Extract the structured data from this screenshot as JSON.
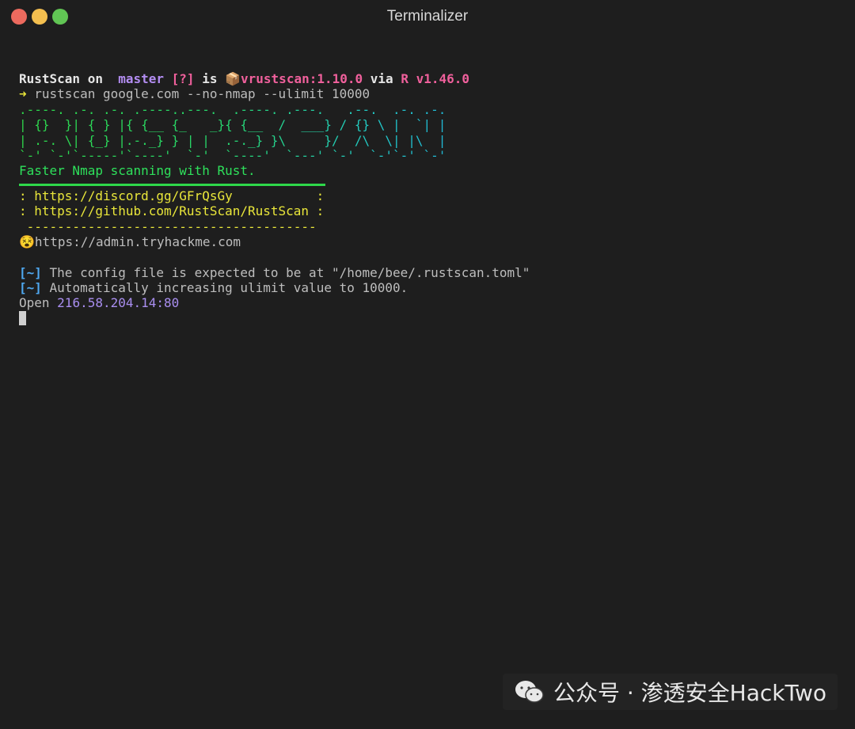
{
  "window": {
    "title": "Terminalizer"
  },
  "prompt": {
    "dir": "RustScan",
    "on": " on ",
    "branch_icon": "",
    "branch": " master",
    "status": " [?]",
    "is": " is ",
    "package_icon": "📦",
    "package": "vrustscan:1.10.0",
    "via": " via ",
    "rust_icon": "R",
    "rust_version": " v1.46.0"
  },
  "command": {
    "arrow": "➜",
    "text": " rustscan google.com --no-nmap --ulimit 10000"
  },
  "banner": {
    "ascii": [
      ".----. .-. .-. .----..---.  .----. .---.   .--.  .-. .-.",
      "| {}  }| { } |{ {__ {_   _}{ {__  /  ___} / {} \\ |  `| |",
      "| .-. \\| {_} |.-._} } | |  .-._} }\\     }/  /\\  \\| |\\  |",
      "`-' `-'`-----'`----'  `-'  `----'  `---' `-'  `-'`-' `-'"
    ],
    "tagline": "Faster Nmap scanning with Rust.",
    "links": [
      ": https://discord.gg/GFrQsGy           :",
      ": https://github.com/RustScan/RustScan :"
    ],
    "dashes": " --------------------------------------",
    "admin_icon": "😵",
    "admin": "https://admin.tryhackme.com"
  },
  "output": [
    {
      "tag": "[~]",
      "text": " The config file is expected to be at \"/home/bee/.rustscan.toml\""
    },
    {
      "tag": "[~]",
      "text": " Automatically increasing ulimit value to 10000."
    }
  ],
  "open": {
    "label": "Open ",
    "address": "216.58.204.14:80"
  },
  "watermark": {
    "text": "公众号 · 渗透安全HackTwo"
  }
}
